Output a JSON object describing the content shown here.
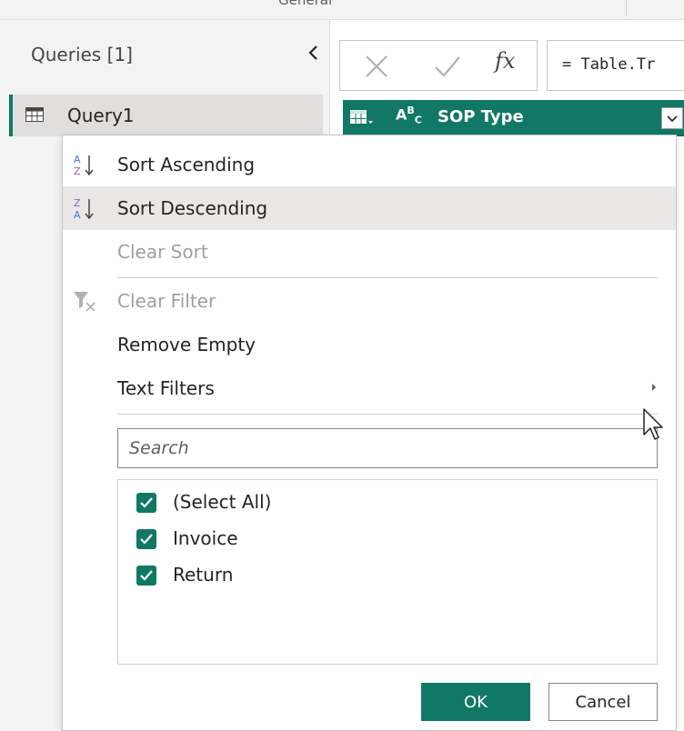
{
  "ribbon": {
    "group_label": "General"
  },
  "queries_pane": {
    "title": "Queries [1]",
    "collapse_icon": "chevron-left-icon",
    "items": [
      {
        "label": "Query1",
        "icon": "table-icon",
        "selected": true
      }
    ]
  },
  "formula_bar": {
    "cancel_icon": "close-icon",
    "confirm_icon": "checkmark-icon",
    "fx_label": "fx",
    "formula": "= Table.Tr"
  },
  "column_header": {
    "type_icon": "table-dropdown-icon",
    "data_type_label": "ABC",
    "name": "SOP Type",
    "filter_icon": "chevron-down-icon"
  },
  "menu": {
    "sort_ascending": "Sort Ascending",
    "sort_descending": "Sort Descending",
    "clear_sort": "Clear Sort",
    "clear_filter": "Clear Filter",
    "remove_empty": "Remove Empty",
    "text_filters": "Text Filters",
    "hovered_item": "Sort Descending",
    "search_placeholder": "Search",
    "checklist": [
      {
        "label": "(Select All)",
        "checked": true
      },
      {
        "label": "Invoice",
        "checked": true
      },
      {
        "label": "Return",
        "checked": true
      }
    ],
    "ok_label": "OK",
    "cancel_label": "Cancel"
  },
  "colors": {
    "accent": "#117865",
    "hover": "#e9e8e7",
    "disabled_text": "#a19f9d"
  }
}
